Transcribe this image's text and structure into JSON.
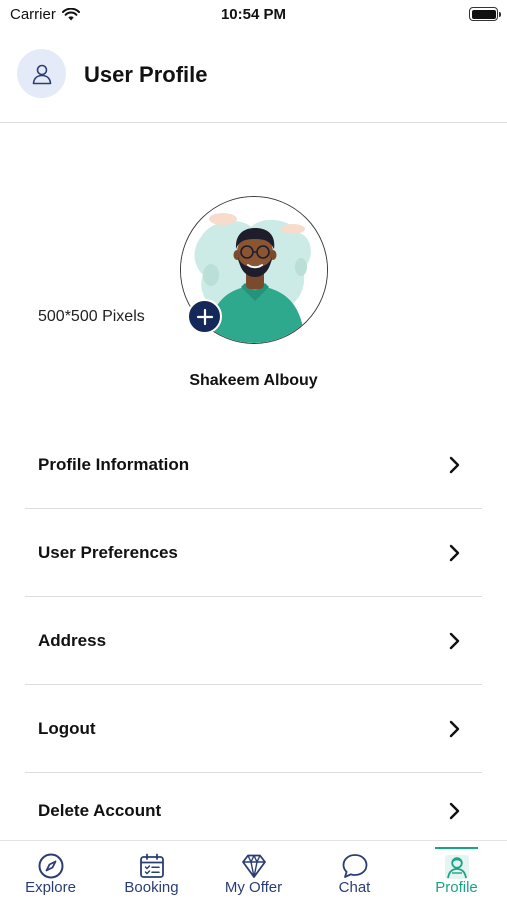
{
  "status_bar": {
    "carrier": "Carrier",
    "time": "10:54 PM"
  },
  "header": {
    "title": "User Profile",
    "icon": "user-icon"
  },
  "profile": {
    "photo_size_hint": "500*500 Pixels",
    "name": "Shakeem Albouy",
    "add_photo_icon": "plus-icon"
  },
  "menu": {
    "items": [
      {
        "label": "Profile Information"
      },
      {
        "label": "User Preferences"
      },
      {
        "label": "Address"
      },
      {
        "label": "Logout"
      },
      {
        "label": "Delete Account"
      }
    ],
    "chevron_icon": "chevron-right-icon"
  },
  "tab_bar": {
    "tabs": [
      {
        "label": "Explore",
        "icon": "compass-icon"
      },
      {
        "label": "Booking",
        "icon": "calendar-icon"
      },
      {
        "label": "My Offer",
        "icon": "diamond-icon"
      },
      {
        "label": "Chat",
        "icon": "chat-bubble-icon"
      },
      {
        "label": "Profile",
        "icon": "profile-icon"
      }
    ],
    "active": "Profile"
  },
  "colors": {
    "accent": "#1aa487",
    "navy": "#14285a",
    "tab_inactive": "#2a3e74",
    "header_avatar_bg": "#e4eaf7"
  }
}
